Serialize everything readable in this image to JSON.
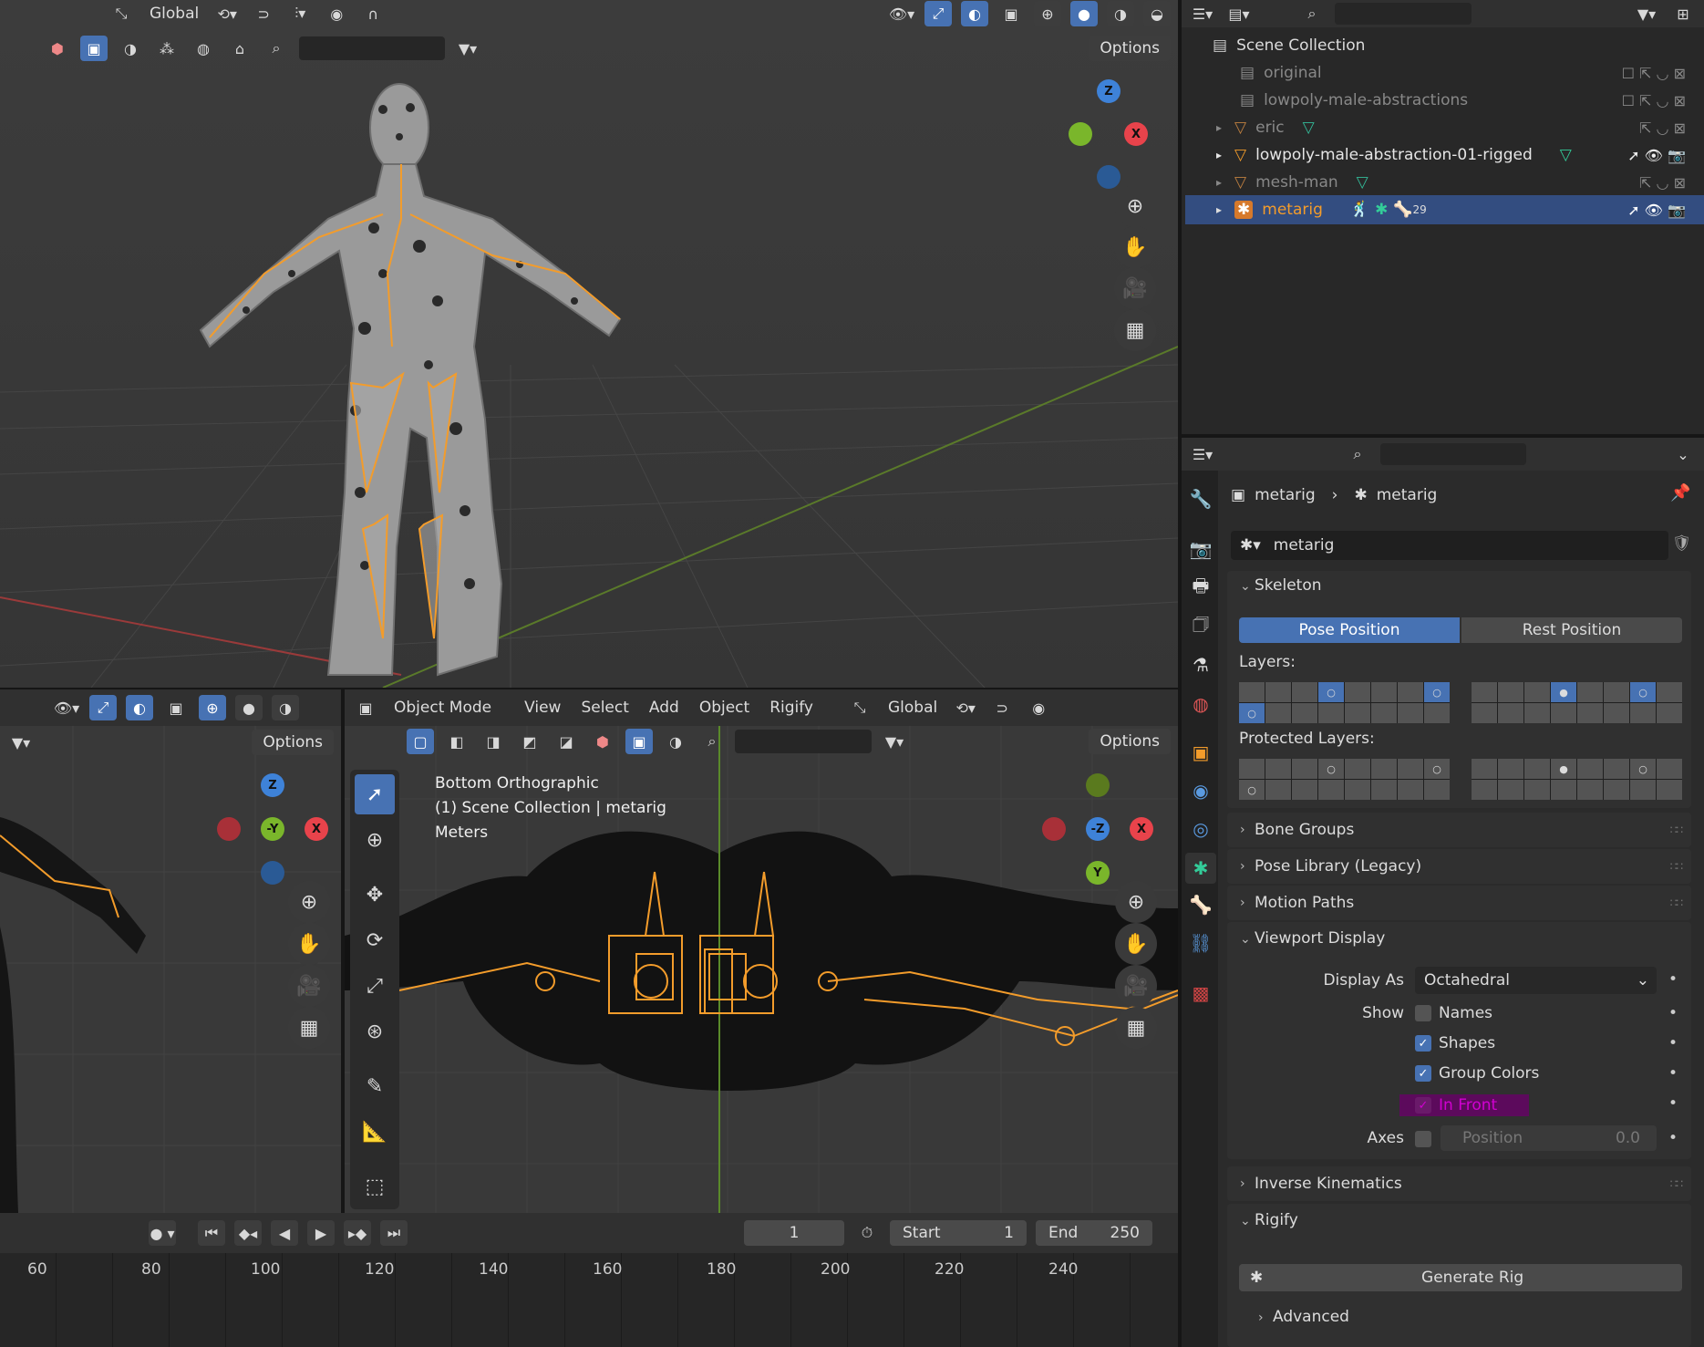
{
  "top_header": {
    "transform": "Global",
    "options": "Options"
  },
  "outliner": {
    "root": "Scene Collection",
    "items": [
      {
        "label": "original",
        "active": false
      },
      {
        "label": "lowpoly-male-abstractions",
        "active": false
      },
      {
        "label": "eric",
        "active": false
      },
      {
        "label": "lowpoly-male-abstraction-01-rigged",
        "active": true
      },
      {
        "label": "mesh-man",
        "active": false
      },
      {
        "label": "metarig",
        "active": true,
        "selected": true,
        "badge": "29"
      }
    ]
  },
  "left_bottom_viewport": {
    "options": "Options"
  },
  "bottom_viewport": {
    "mode": "Object Mode",
    "menus": [
      "View",
      "Select",
      "Add",
      "Object",
      "Rigify"
    ],
    "transform": "Global",
    "options": "Options",
    "overlay_lines": [
      "Bottom Orthographic",
      "(1) Scene Collection | metarig",
      "Meters"
    ]
  },
  "timeline": {
    "current_frame": "1",
    "start_label": "Start",
    "start_value": "1",
    "end_label": "End",
    "end_value": "250",
    "ruler": [
      "60",
      "80",
      "100",
      "120",
      "140",
      "160",
      "180",
      "200",
      "220",
      "240"
    ]
  },
  "properties": {
    "breadcrumb_object": "metarig",
    "breadcrumb_data": "metarig",
    "datablock_name": "metarig",
    "skeleton": {
      "title": "Skeleton",
      "pose_position": "Pose Position",
      "rest_position": "Rest Position",
      "layers_label": "Layers:",
      "protected_label": "Protected Layers:"
    },
    "collapsed_panels": [
      "Bone Groups",
      "Pose Library (Legacy)",
      "Motion Paths"
    ],
    "viewport_display": {
      "title": "Viewport Display",
      "display_as_label": "Display As",
      "display_as_value": "Octahedral",
      "show_label": "Show",
      "names": "Names",
      "shapes": "Shapes",
      "group_colors": "Group Colors",
      "in_front": "In Front",
      "axes_label": "Axes",
      "position_label": "Position",
      "position_value": "0.0"
    },
    "ik_panel": "Inverse Kinematics",
    "rigify": {
      "title": "Rigify",
      "generate": "Generate Rig",
      "advanced": "Advanced"
    }
  },
  "colors": {
    "accent": "#4772b3",
    "bone_orange": "#f39c2b",
    "axis_x": "#e8434b",
    "axis_y": "#7ab62b",
    "axis_z": "#3e82d8"
  }
}
